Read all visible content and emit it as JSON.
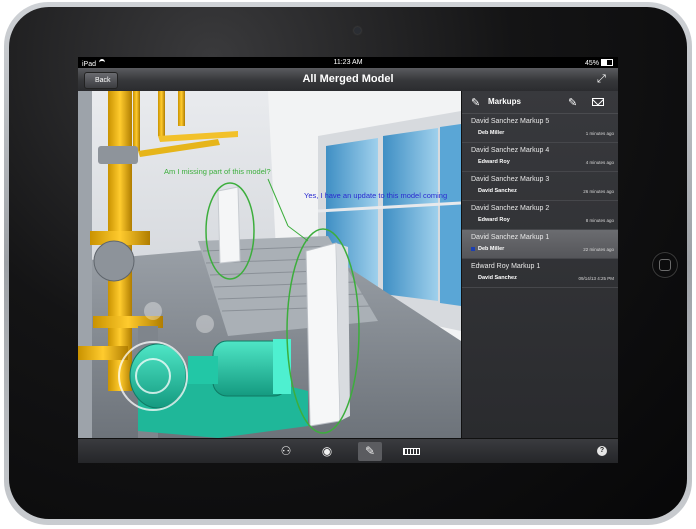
{
  "status_bar": {
    "carrier": "iPad",
    "time": "11:23 AM",
    "battery": "45%"
  },
  "nav": {
    "back_label": "Back",
    "title": "All Merged Model"
  },
  "viewport": {
    "annotation_1": "Am I missing part of this model?",
    "annotation_2": "Yes, I have an update to this model coming",
    "colors": {
      "annotation_1": "#3cae3c",
      "annotation_2": "#2b2bd0"
    }
  },
  "panel": {
    "title": "Markups",
    "items": [
      {
        "title": "David Sanchez Markup 5",
        "author": "Deb Miller",
        "time": "1 minutes ago",
        "selected": false
      },
      {
        "title": "David Sanchez Markup 4",
        "author": "Edward Roy",
        "time": "4 minutes ago",
        "selected": false
      },
      {
        "title": "David Sanchez Markup 3",
        "author": "David Sanchez",
        "time": "26 minutes ago",
        "selected": false
      },
      {
        "title": "David Sanchez Markup 2",
        "author": "Edward Roy",
        "time": "8 minutes ago",
        "selected": false
      },
      {
        "title": "David Sanchez Markup 1",
        "author": "Deb Miller",
        "time": "22 minutes ago",
        "selected": true
      },
      {
        "title": "Edward Roy Markup 1",
        "author": "David Sanchez",
        "time": "09/14/13 4:25 PM",
        "selected": false
      }
    ]
  },
  "toolbar": {
    "help_label": "?"
  }
}
